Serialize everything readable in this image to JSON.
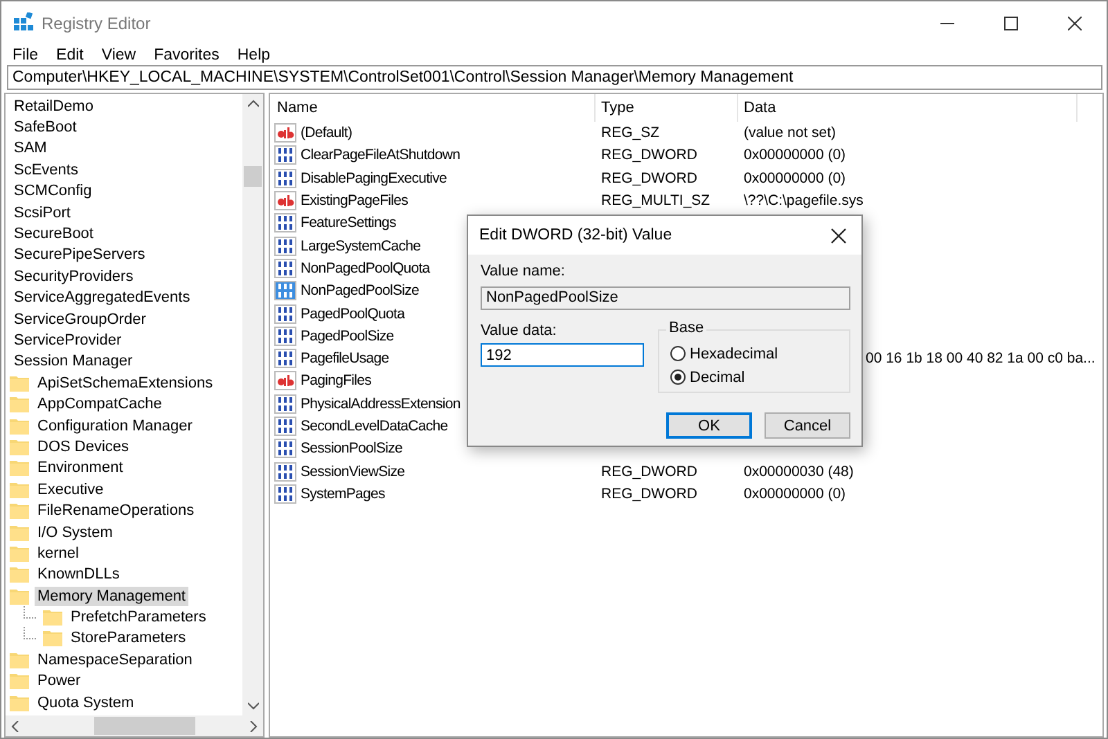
{
  "window": {
    "title": "Registry Editor"
  },
  "menu": [
    "File",
    "Edit",
    "View",
    "Favorites",
    "Help"
  ],
  "address": "Computer\\HKEY_LOCAL_MACHINE\\SYSTEM\\ControlSet001\\Control\\Session Manager\\Memory Management",
  "tree": [
    {
      "label": "RetailDemo",
      "selected": false
    },
    {
      "label": "SafeBoot",
      "selected": false
    },
    {
      "label": "SAM",
      "selected": false
    },
    {
      "label": "ScEvents",
      "selected": false
    },
    {
      "label": "SCMConfig",
      "selected": false
    },
    {
      "label": "ScsiPort",
      "selected": false
    },
    {
      "label": "SecureBoot",
      "selected": false
    },
    {
      "label": "SecurePipeServers",
      "selected": false
    },
    {
      "label": "SecurityProviders",
      "selected": false
    },
    {
      "label": "ServiceAggregatedEvents",
      "selected": false
    },
    {
      "label": "ServiceGroupOrder",
      "selected": false
    },
    {
      "label": "ServiceProvider",
      "selected": false
    },
    {
      "label": "Session Manager",
      "selected": false,
      "children": [
        {
          "label": "ApiSetSchemaExtensions",
          "selected": false
        },
        {
          "label": "AppCompatCache",
          "selected": false
        },
        {
          "label": "Configuration Manager",
          "selected": false
        },
        {
          "label": "DOS Devices",
          "selected": false
        },
        {
          "label": "Environment",
          "selected": false
        },
        {
          "label": "Executive",
          "selected": false
        },
        {
          "label": "FileRenameOperations",
          "selected": false
        },
        {
          "label": "I/O System",
          "selected": false
        },
        {
          "label": "kernel",
          "selected": false
        },
        {
          "label": "KnownDLLs",
          "selected": false
        },
        {
          "label": "Memory Management",
          "selected": true,
          "children": [
            {
              "label": "PrefetchParameters",
              "selected": false
            },
            {
              "label": "StoreParameters",
              "selected": false
            }
          ]
        },
        {
          "label": "NamespaceSeparation",
          "selected": false
        },
        {
          "label": "Power",
          "selected": false
        },
        {
          "label": "Quota System",
          "selected": false
        }
      ]
    }
  ],
  "columns": [
    "Name",
    "Type",
    "Data"
  ],
  "values": [
    {
      "kind": "string",
      "name": "(Default)",
      "type": "REG_SZ",
      "data": "(value not set)",
      "selected": false
    },
    {
      "kind": "binary",
      "name": "ClearPageFileAtShutdown",
      "type": "REG_DWORD",
      "data": "0x00000000 (0)",
      "selected": false
    },
    {
      "kind": "binary",
      "name": "DisablePagingExecutive",
      "type": "REG_DWORD",
      "data": "0x00000000 (0)",
      "selected": false
    },
    {
      "kind": "string",
      "name": "ExistingPageFiles",
      "type": "REG_MULTI_SZ",
      "data": "\\??\\C:\\pagefile.sys",
      "selected": false
    },
    {
      "kind": "binary",
      "name": "FeatureSettings",
      "selected": false
    },
    {
      "kind": "binary",
      "name": "LargeSystemCache",
      "selected": false
    },
    {
      "kind": "binary",
      "name": "NonPagedPoolQuota",
      "selected": false
    },
    {
      "kind": "binary",
      "name": "NonPagedPoolSize",
      "selected": true
    },
    {
      "kind": "binary",
      "name": "PagedPoolQuota",
      "selected": false
    },
    {
      "kind": "binary",
      "name": "PagedPoolSize",
      "selected": false
    },
    {
      "kind": "binary",
      "name": "PagefileUsage",
      "data": "00 16 1b 18 00 40 82 1a 00 c0 ba...",
      "partial": true,
      "selected": false
    },
    {
      "kind": "string",
      "name": "PagingFiles",
      "selected": false
    },
    {
      "kind": "binary",
      "name": "PhysicalAddressExtension",
      "selected": false
    },
    {
      "kind": "binary",
      "name": "SecondLevelDataCache",
      "selected": false
    },
    {
      "kind": "binary",
      "name": "SessionPoolSize",
      "selected": false
    },
    {
      "kind": "binary",
      "name": "SessionViewSize",
      "type": "REG_DWORD",
      "data": "0x00000030 (48)",
      "selected": false
    },
    {
      "kind": "binary",
      "name": "SystemPages",
      "type": "REG_DWORD",
      "data": "0x00000000 (0)",
      "selected": false
    }
  ],
  "dialog": {
    "title": "Edit DWORD (32-bit) Value",
    "name_label": "Value name:",
    "name_value": "NonPagedPoolSize",
    "data_label": "Value data:",
    "data_value": "192",
    "base_label": "Base",
    "bases": [
      {
        "label": "Hexadecimal",
        "selected": false
      },
      {
        "label": "Decimal",
        "selected": true
      }
    ],
    "buttons": [
      "OK",
      "Cancel"
    ]
  }
}
